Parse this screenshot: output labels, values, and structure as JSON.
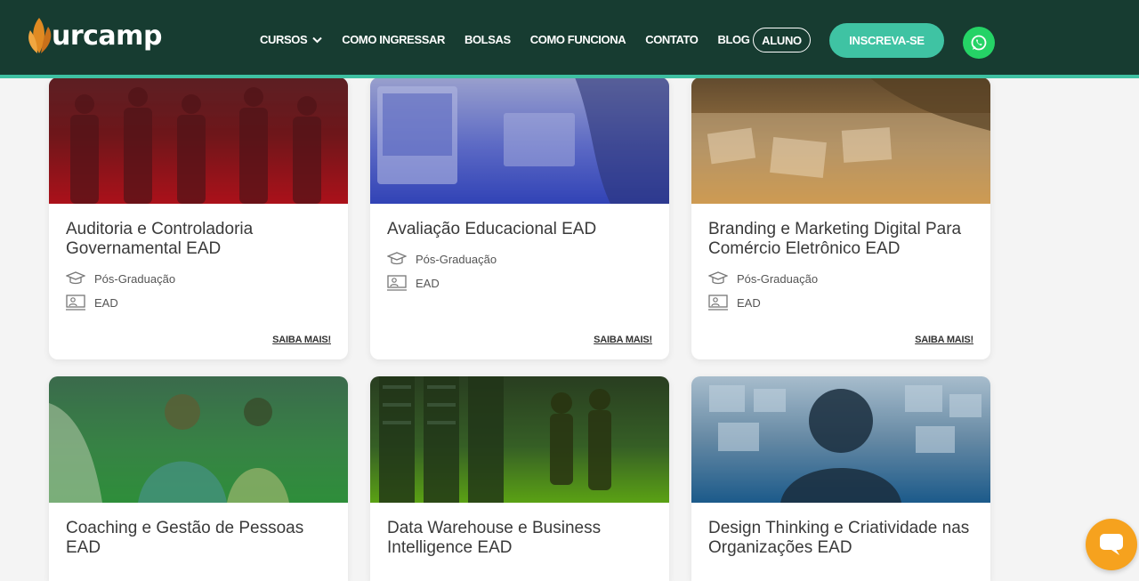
{
  "header": {
    "logo_text": "urcamp",
    "nav": [
      {
        "label": "CURSOS",
        "has_dropdown": true
      },
      {
        "label": "COMO INGRESSAR"
      },
      {
        "label": "BOLSAS"
      },
      {
        "label": "COMO FUNCIONA"
      },
      {
        "label": "CONTATO"
      },
      {
        "label": "BLOG"
      }
    ],
    "aluno_label": "ALUNO",
    "inscreva_label": "INSCREVA-SE"
  },
  "cards": [
    {
      "title": "Auditoria e Controladoria Governamental EAD",
      "level": "Pós-Graduação",
      "modality": "EAD",
      "cta": "SAIBA MAIS!",
      "tint": "#b8101a"
    },
    {
      "title": "Avaliação Educacional EAD",
      "level": "Pós-Graduação",
      "modality": "EAD",
      "cta": "SAIBA MAIS!",
      "tint": "#3345b5"
    },
    {
      "title": "Branding e Marketing Digital Para Comércio Eletrônico EAD",
      "level": "Pós-Graduação",
      "modality": "EAD",
      "cta": "SAIBA MAIS!",
      "tint": "#c8801c"
    },
    {
      "title": "Coaching e Gestão de Pessoas EAD",
      "tint": "#2e8a3a"
    },
    {
      "title": "Data Warehouse e Business Intelligence EAD",
      "tint": "#5aa014"
    },
    {
      "title": "Design Thinking e Criatividade nas Organizações EAD",
      "tint": "#1c5a8a"
    }
  ],
  "colors": {
    "header_bg": "#173c31",
    "accent": "#3fc3a3",
    "whatsapp": "#25d366",
    "chat": "#f6a21e"
  }
}
